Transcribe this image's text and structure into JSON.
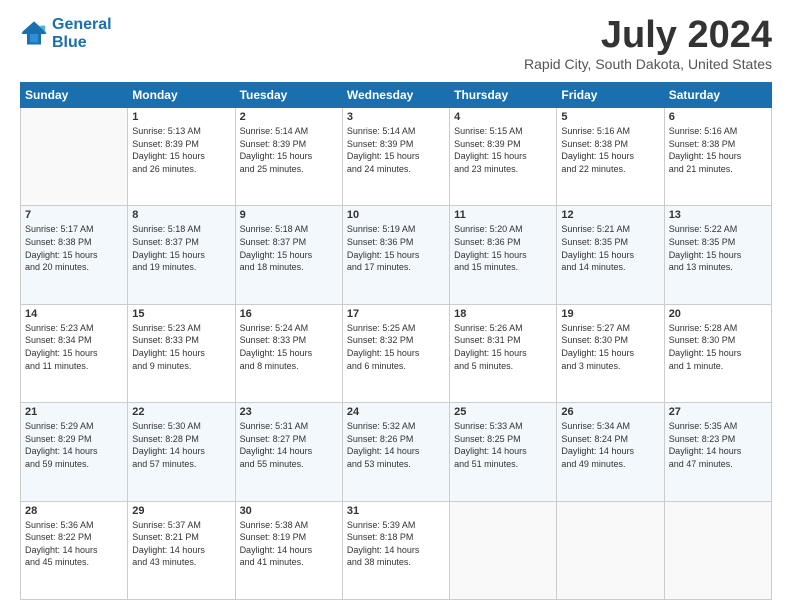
{
  "logo": {
    "line1": "General",
    "line2": "Blue"
  },
  "title": "July 2024",
  "subtitle": "Rapid City, South Dakota, United States",
  "headers": [
    "Sunday",
    "Monday",
    "Tuesday",
    "Wednesday",
    "Thursday",
    "Friday",
    "Saturday"
  ],
  "weeks": [
    [
      {
        "day": "",
        "info": ""
      },
      {
        "day": "1",
        "info": "Sunrise: 5:13 AM\nSunset: 8:39 PM\nDaylight: 15 hours\nand 26 minutes."
      },
      {
        "day": "2",
        "info": "Sunrise: 5:14 AM\nSunset: 8:39 PM\nDaylight: 15 hours\nand 25 minutes."
      },
      {
        "day": "3",
        "info": "Sunrise: 5:14 AM\nSunset: 8:39 PM\nDaylight: 15 hours\nand 24 minutes."
      },
      {
        "day": "4",
        "info": "Sunrise: 5:15 AM\nSunset: 8:39 PM\nDaylight: 15 hours\nand 23 minutes."
      },
      {
        "day": "5",
        "info": "Sunrise: 5:16 AM\nSunset: 8:38 PM\nDaylight: 15 hours\nand 22 minutes."
      },
      {
        "day": "6",
        "info": "Sunrise: 5:16 AM\nSunset: 8:38 PM\nDaylight: 15 hours\nand 21 minutes."
      }
    ],
    [
      {
        "day": "7",
        "info": "Sunrise: 5:17 AM\nSunset: 8:38 PM\nDaylight: 15 hours\nand 20 minutes."
      },
      {
        "day": "8",
        "info": "Sunrise: 5:18 AM\nSunset: 8:37 PM\nDaylight: 15 hours\nand 19 minutes."
      },
      {
        "day": "9",
        "info": "Sunrise: 5:18 AM\nSunset: 8:37 PM\nDaylight: 15 hours\nand 18 minutes."
      },
      {
        "day": "10",
        "info": "Sunrise: 5:19 AM\nSunset: 8:36 PM\nDaylight: 15 hours\nand 17 minutes."
      },
      {
        "day": "11",
        "info": "Sunrise: 5:20 AM\nSunset: 8:36 PM\nDaylight: 15 hours\nand 15 minutes."
      },
      {
        "day": "12",
        "info": "Sunrise: 5:21 AM\nSunset: 8:35 PM\nDaylight: 15 hours\nand 14 minutes."
      },
      {
        "day": "13",
        "info": "Sunrise: 5:22 AM\nSunset: 8:35 PM\nDaylight: 15 hours\nand 13 minutes."
      }
    ],
    [
      {
        "day": "14",
        "info": "Sunrise: 5:23 AM\nSunset: 8:34 PM\nDaylight: 15 hours\nand 11 minutes."
      },
      {
        "day": "15",
        "info": "Sunrise: 5:23 AM\nSunset: 8:33 PM\nDaylight: 15 hours\nand 9 minutes."
      },
      {
        "day": "16",
        "info": "Sunrise: 5:24 AM\nSunset: 8:33 PM\nDaylight: 15 hours\nand 8 minutes."
      },
      {
        "day": "17",
        "info": "Sunrise: 5:25 AM\nSunset: 8:32 PM\nDaylight: 15 hours\nand 6 minutes."
      },
      {
        "day": "18",
        "info": "Sunrise: 5:26 AM\nSunset: 8:31 PM\nDaylight: 15 hours\nand 5 minutes."
      },
      {
        "day": "19",
        "info": "Sunrise: 5:27 AM\nSunset: 8:30 PM\nDaylight: 15 hours\nand 3 minutes."
      },
      {
        "day": "20",
        "info": "Sunrise: 5:28 AM\nSunset: 8:30 PM\nDaylight: 15 hours\nand 1 minute."
      }
    ],
    [
      {
        "day": "21",
        "info": "Sunrise: 5:29 AM\nSunset: 8:29 PM\nDaylight: 14 hours\nand 59 minutes."
      },
      {
        "day": "22",
        "info": "Sunrise: 5:30 AM\nSunset: 8:28 PM\nDaylight: 14 hours\nand 57 minutes."
      },
      {
        "day": "23",
        "info": "Sunrise: 5:31 AM\nSunset: 8:27 PM\nDaylight: 14 hours\nand 55 minutes."
      },
      {
        "day": "24",
        "info": "Sunrise: 5:32 AM\nSunset: 8:26 PM\nDaylight: 14 hours\nand 53 minutes."
      },
      {
        "day": "25",
        "info": "Sunrise: 5:33 AM\nSunset: 8:25 PM\nDaylight: 14 hours\nand 51 minutes."
      },
      {
        "day": "26",
        "info": "Sunrise: 5:34 AM\nSunset: 8:24 PM\nDaylight: 14 hours\nand 49 minutes."
      },
      {
        "day": "27",
        "info": "Sunrise: 5:35 AM\nSunset: 8:23 PM\nDaylight: 14 hours\nand 47 minutes."
      }
    ],
    [
      {
        "day": "28",
        "info": "Sunrise: 5:36 AM\nSunset: 8:22 PM\nDaylight: 14 hours\nand 45 minutes."
      },
      {
        "day": "29",
        "info": "Sunrise: 5:37 AM\nSunset: 8:21 PM\nDaylight: 14 hours\nand 43 minutes."
      },
      {
        "day": "30",
        "info": "Sunrise: 5:38 AM\nSunset: 8:19 PM\nDaylight: 14 hours\nand 41 minutes."
      },
      {
        "day": "31",
        "info": "Sunrise: 5:39 AM\nSunset: 8:18 PM\nDaylight: 14 hours\nand 38 minutes."
      },
      {
        "day": "",
        "info": ""
      },
      {
        "day": "",
        "info": ""
      },
      {
        "day": "",
        "info": ""
      }
    ]
  ]
}
